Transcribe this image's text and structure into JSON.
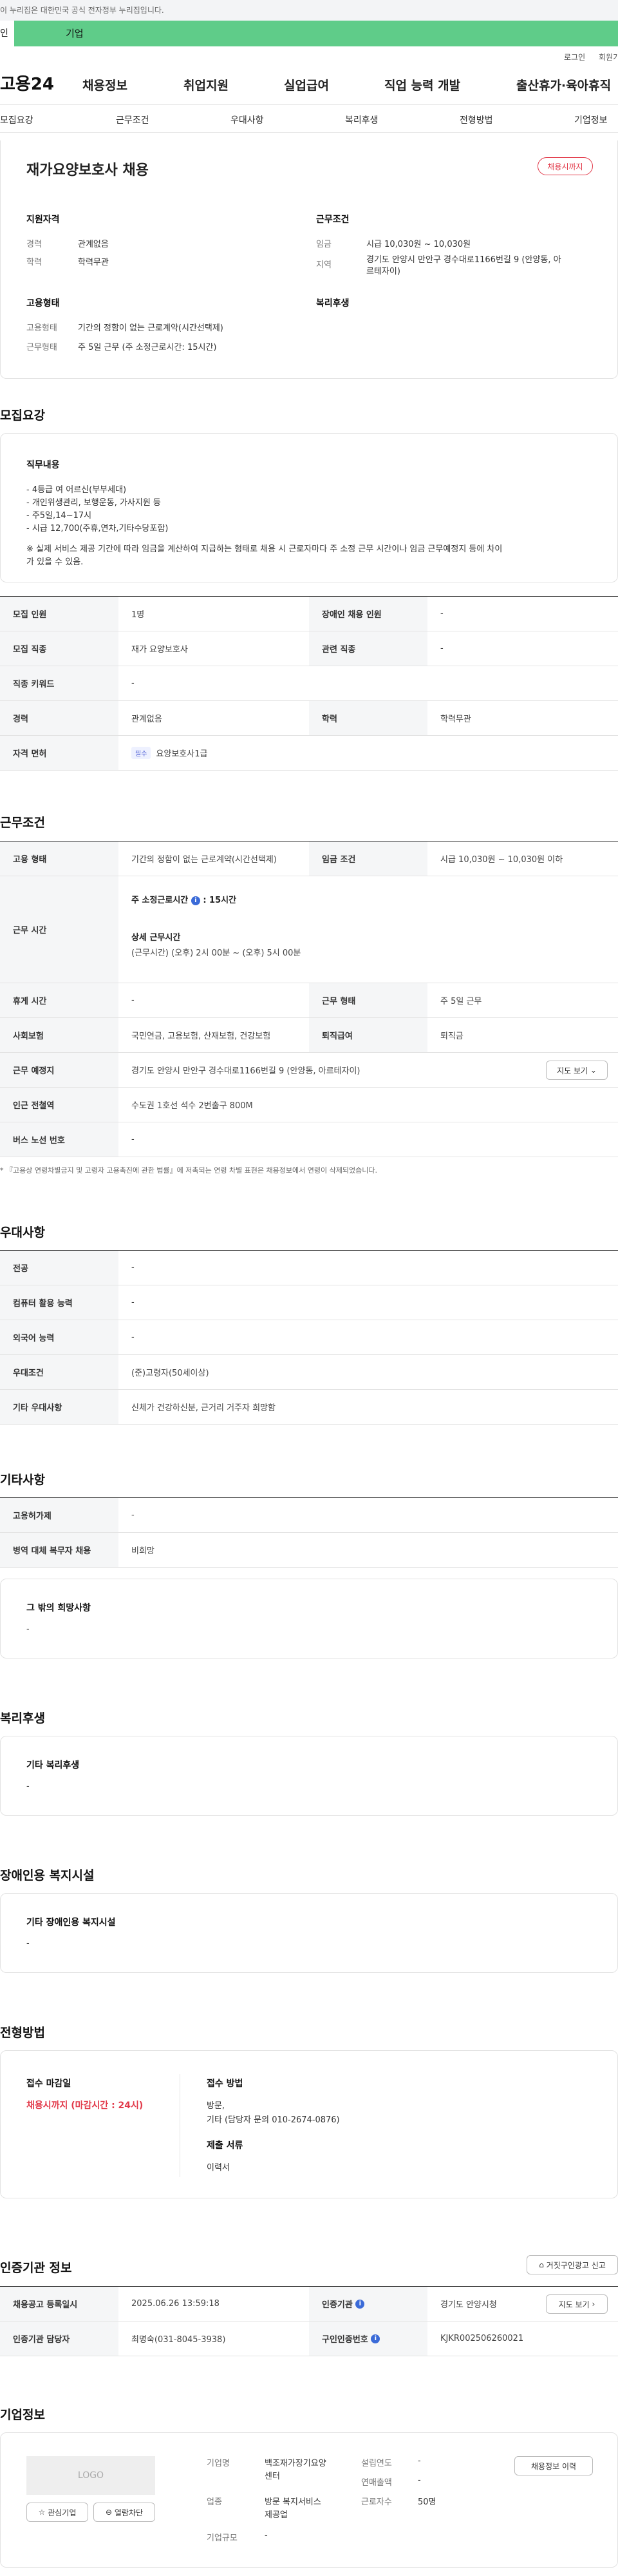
{
  "gov_banner": "이 누리집은 대한민국 공식 전자정부 누리집입니다.",
  "auth": {
    "left": "인",
    "company": "기업"
  },
  "util": {
    "login": "로그인",
    "join": "회원가"
  },
  "gnb": {
    "logo": "고용24",
    "menu": [
      "채용정보",
      "취업지원",
      "실업급여",
      "직업 능력 개발",
      "출산휴가·육아휴직"
    ]
  },
  "tabs": [
    "모집요강",
    "근무조건",
    "우대사항",
    "복리후생",
    "전형방법",
    "기업정보"
  ],
  "summary": {
    "title": "재가요양보호사 채용",
    "badge": "채용시까지",
    "qual_h": "지원자격",
    "career_l": "경력",
    "career_v": "관계없음",
    "edu_l": "학력",
    "edu_v": "학력무관",
    "cond_h": "근무조건",
    "wage_l": "임금",
    "wage_v": "시급 10,030원 ~ 10,030원",
    "area_l": "지역",
    "area_v1": "경기도 안양시 만안구 경수대로1166번길 9 (안양동, 아",
    "area_v2": "르테자이)",
    "emp_h": "고용형태",
    "emp_l": "고용형태",
    "emp_v": "기간의 정함이 없는 근로계약(시간선택제)",
    "work_l": "근무형태",
    "work_v": "주 5일 근무 (주 소정근로시간: 15시간)",
    "welfare_h": "복리후생"
  },
  "recruit": {
    "h": "모집요강",
    "duty_h": "직무내용",
    "duty_lines": [
      "- 4등급 여 어르신(부부세대)",
      "- 개인위생관리, 보행운동, 가사지원 등",
      "- 주5일,14~17시",
      "- 시급 12,700(주휴,연차,기타수당포함)"
    ],
    "note1": "※ 실제 서비스 제공 기간에 따라 임금을 계산하여 지급하는 형태로 채용 시 근로자마다 주 소정 근무 시간이나 임금 근무예정지 등에 차이",
    "note2": "가 있을 수 있음.",
    "rows": [
      [
        "모집 인원",
        "1명",
        "장애인 채용 인원",
        "-"
      ],
      [
        "모집 직종",
        "재가 요양보호사",
        "관련 직종",
        "-"
      ],
      [
        "직종 키워드",
        "-",
        "",
        ""
      ],
      [
        "경력",
        "관계없음",
        "학력",
        "학력무관"
      ],
      [
        "자격 면허",
        "요양보호사1급",
        "",
        ""
      ]
    ],
    "cert_tag": "필수"
  },
  "conditions": {
    "h": "근무조건",
    "emp_l": "고용 형태",
    "emp_v": "기간의 정함이 없는 근로계약(시간선택제)",
    "wage_l": "임금 조건",
    "wage_v": "시급 10,030원 ~ 10,030원 이하",
    "hours_l": "근무 시간",
    "hours_a": "주 소정근로시간",
    "hours_a2": ": 15시간",
    "hours_b": "상세 근무시간",
    "hours_c": "(근무시간) (오후) 2시 00분 ~ (오후) 5시 00분",
    "rows": [
      [
        "휴게 시간",
        "-",
        "근무 형태",
        "주 5일 근무"
      ],
      [
        "사회보험",
        "국민연금, 고용보험, 산재보험, 건강보험",
        "퇴직급여",
        "퇴직금"
      ],
      [
        "근무 예정지",
        "경기도 안양시 만안구 경수대로1166번길 9 (안양동, 아르테자이)",
        "",
        ""
      ],
      [
        "인근 전철역",
        "수도권 1호선 석수 2번출구 800M",
        "",
        ""
      ],
      [
        "버스 노선 번호",
        "-",
        "",
        ""
      ]
    ],
    "map_btn": "지도 보기",
    "footnote": "* 『고용상 연령차별금지 및 고령자 고용촉진에 관한 법률』에 저촉되는 연령 차별 표현은 채용정보에서 연령이 삭제되었습니다."
  },
  "pref": {
    "h": "우대사항",
    "rows": [
      [
        "전공",
        "-"
      ],
      [
        "컴퓨터 활용 능력",
        "-"
      ],
      [
        "외국어 능력",
        "-"
      ],
      [
        "우대조건",
        "(준)고령자(50세이상)"
      ],
      [
        "기타 우대사항",
        "신체가 건강하신분, 근거리 거주자 희망함"
      ]
    ]
  },
  "etc": {
    "h": "기타사항",
    "rows": [
      [
        "고용허가제",
        "-"
      ],
      [
        "병역 대체 복무자 채용",
        "비희망"
      ]
    ],
    "box_h": "그 밖의 희망사항",
    "box_v": "-"
  },
  "welfare": {
    "h": "복리후생",
    "box_h": "기타 복리후생",
    "box_v": "-"
  },
  "disab": {
    "h": "장애인용 복지시설",
    "box_h": "기타 장애인용 복지시설",
    "box_v": "-"
  },
  "process": {
    "h": "전형방법",
    "deadline_h": "접수 마감일",
    "deadline_v": "채용시까지 (마감시간 : 24시)",
    "method_h": "접수 방법",
    "method_v1": "방문,",
    "method_v2": "기타 (담당자 문의 010-2674-0876)",
    "docs_h": "제출 서류",
    "docs_v": "이력서"
  },
  "agency": {
    "h": "인증기관 정보",
    "report_btn": "거짓구인광고 신고",
    "rows": [
      [
        "채용공고 등록일시",
        "2025.06.26 13:59:18",
        "인증기관",
        "경기도 안양시청"
      ],
      [
        "인증기관 담당자",
        "최명숙(031-8045-3938)",
        "구인인증번호",
        "KJKR002506260021"
      ]
    ],
    "map_btn": "지도 보기"
  },
  "company": {
    "h": "기업정보",
    "logo": "LOGO",
    "fav_btn": "관심기업",
    "block_btn": "열람차단",
    "name_l": "기업명",
    "name_v1": "백조재가장기요양",
    "name_v2": "센터",
    "ind_l": "업종",
    "ind_v1": "방문 복지서비스",
    "ind_v2": "제공업",
    "size_l": "기업규모",
    "size_v": "-",
    "year_l": "설립연도",
    "year_v": "-",
    "sales_l": "연매출액",
    "sales_v": "-",
    "emp_l": "근로자수",
    "emp_v": "50명",
    "more_btn": "채용정보 이력"
  }
}
